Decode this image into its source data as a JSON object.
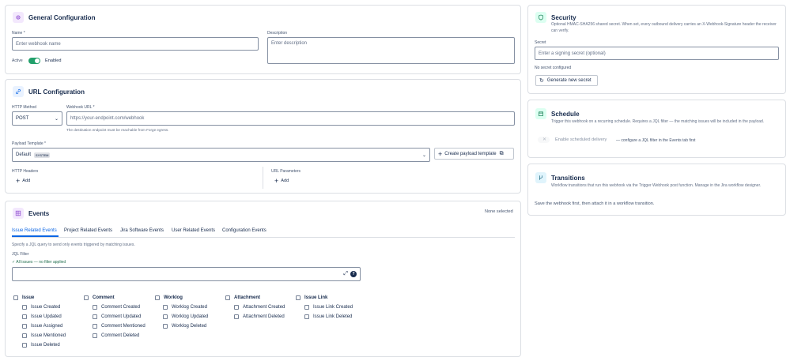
{
  "general": {
    "title": "General Configuration",
    "name_label": "Name *",
    "name_placeholder": "Enter webhook name",
    "description_label": "Description",
    "description_placeholder": "Enter description",
    "active_label": "Active",
    "enabled_label": "Enabled"
  },
  "url": {
    "title": "URL Configuration",
    "method_label": "HTTP Method",
    "method_value": "POST",
    "webhook_url_label": "Webhook URL *",
    "webhook_url_placeholder": "https://your-endpoint.com/webhook",
    "webhook_url_hint": "The destination endpoint must be reachable from Forge egress.",
    "payload_label": "Payload Template *",
    "payload_value": "Default",
    "payload_badge": "SYSTEM",
    "create_template_label": "Create payload template",
    "headers_label": "HTTP Headers",
    "headers_add": "Add",
    "params_label": "URL Parameters",
    "params_add": "Add"
  },
  "events": {
    "title": "Events",
    "selected_status": "None selected",
    "tabs": [
      {
        "label": "Issue Related Events"
      },
      {
        "label": "Project Related Events"
      },
      {
        "label": "Jira Software Events"
      },
      {
        "label": "User Related Events"
      },
      {
        "label": "Configuration Events"
      }
    ],
    "jql_hint": "Specify a JQL query to send only events triggered by matching issues.",
    "jql_label": "JQL Filter",
    "jql_status": "✓ All issues — no filter applied",
    "groups": [
      {
        "label": "Issue",
        "items": [
          "Issue Created",
          "Issue Updated",
          "Issue Assigned",
          "Issue Mentioned",
          "Issue Deleted"
        ]
      },
      {
        "label": "Comment",
        "items": [
          "Comment Created",
          "Comment Updated",
          "Comment Mentioned",
          "Comment Deleted"
        ]
      },
      {
        "label": "Worklog",
        "items": [
          "Worklog Created",
          "Worklog Updated",
          "Worklog Deleted"
        ]
      },
      {
        "label": "Attachment",
        "items": [
          "Attachment Created",
          "Attachment Deleted"
        ]
      },
      {
        "label": "Issue Link",
        "items": [
          "Issue Link Created",
          "Issue Link Deleted"
        ]
      }
    ]
  },
  "security": {
    "title": "Security",
    "description": "Optional HMAC-SHA256 shared secret. When set, every outbound delivery carries an X-Webhook-Signature header the receiver can verify.",
    "secret_label": "Secret",
    "secret_placeholder": "Enter a signing secret (optional)",
    "status": "No secret configured",
    "generate_label": "Generate new secret"
  },
  "schedule": {
    "title": "Schedule",
    "description": "Trigger this webhook on a recurring schedule. Requires a JQL filter — the matching issues will be included in the payload.",
    "toggle_label": "Enable scheduled delivery",
    "toggle_note": "— configure a JQL filter in the Events tab first"
  },
  "transitions": {
    "title": "Transitions",
    "description": "Workflow transitions that run this webhook via the Trigger Webhook post function. Manage in the Jira workflow designer.",
    "note": "Save the webhook first, then attach it in a workflow transition."
  },
  "colors": {
    "accent": "#0c66e4",
    "toggle_on": "#22a06b",
    "general_icon_bg": "#f3e8fd",
    "url_icon_bg": "#e9f2ff",
    "events_icon_bg": "#f3e8fd",
    "security_icon_bg": "#dcfff1",
    "schedule_icon_bg": "#dcfff1",
    "transitions_icon_bg": "#e0f4fc"
  },
  "icons": {
    "general": "gear-icon",
    "url": "link-icon",
    "events": "grid-icon",
    "security": "shield-icon",
    "schedule": "calendar-icon",
    "transitions": "branch-icon"
  }
}
